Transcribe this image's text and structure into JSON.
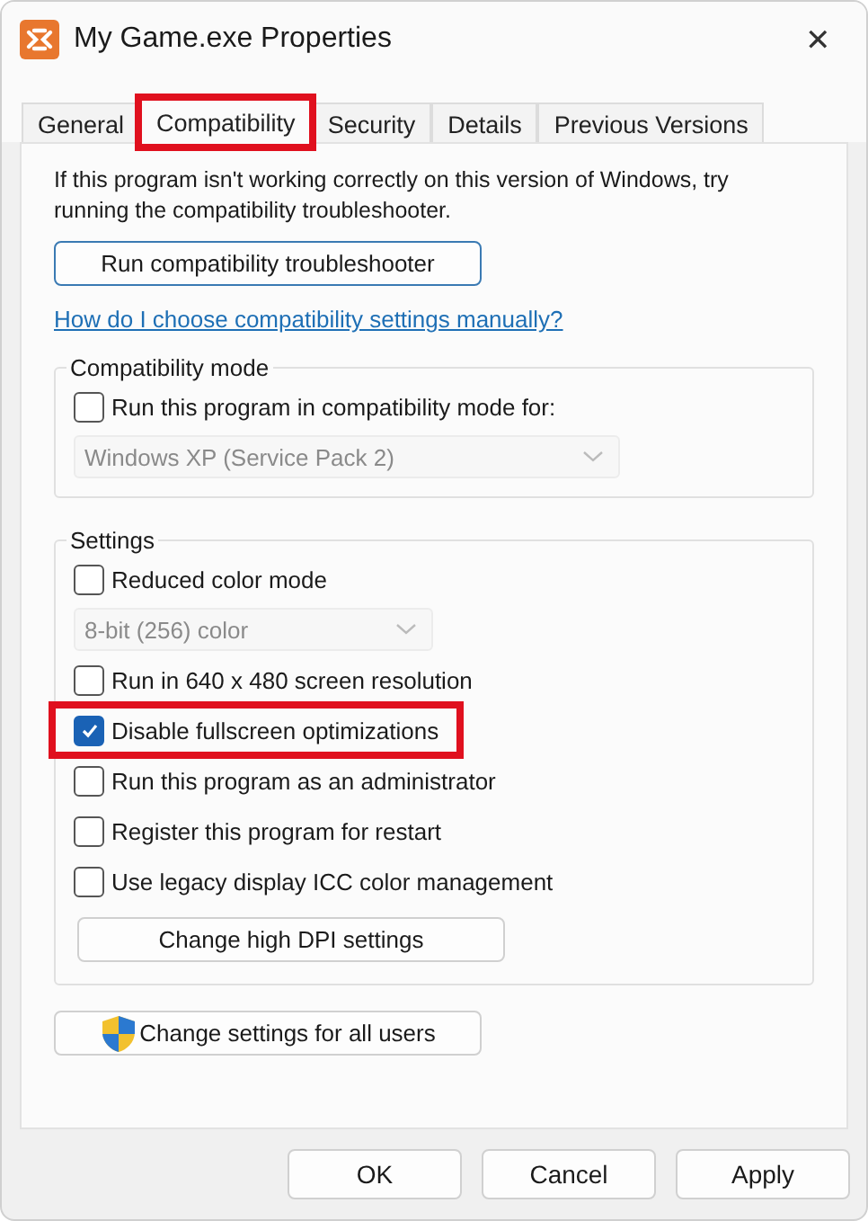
{
  "window": {
    "title": "My Game.exe Properties",
    "close": "✕"
  },
  "tabs": [
    {
      "label": "General",
      "selected": false,
      "highlighted": false
    },
    {
      "label": "Compatibility",
      "selected": true,
      "highlighted": true
    },
    {
      "label": "Security",
      "selected": false,
      "highlighted": false
    },
    {
      "label": "Details",
      "selected": false,
      "highlighted": false
    },
    {
      "label": "Previous Versions",
      "selected": false,
      "highlighted": false
    }
  ],
  "intro": "If this program isn't working correctly on this version of Windows, try running the compatibility troubleshooter.",
  "troubleshooter_button": "Run compatibility troubleshooter",
  "help_link": "How do I choose compatibility settings manually?",
  "groups": [
    {
      "title": "Compatibility mode",
      "items": [
        {
          "kind": "checkbox",
          "label": "Run this program in compatibility mode for:",
          "checked": false,
          "highlighted": false
        },
        {
          "kind": "select",
          "value": "Windows XP (Service Pack 2)",
          "disabled": true
        }
      ]
    },
    {
      "title": "Settings",
      "items": [
        {
          "kind": "checkbox",
          "label": "Reduced color mode",
          "checked": false,
          "highlighted": false
        },
        {
          "kind": "select",
          "value": "8-bit (256) color",
          "disabled": true
        },
        {
          "kind": "checkbox",
          "label": "Run in 640 x 480 screen resolution",
          "checked": false,
          "highlighted": false
        },
        {
          "kind": "checkbox",
          "label": "Disable fullscreen optimizations",
          "checked": true,
          "highlighted": true
        },
        {
          "kind": "checkbox",
          "label": "Run this program as an administrator",
          "checked": false,
          "highlighted": false
        },
        {
          "kind": "checkbox",
          "label": "Register this program for restart",
          "checked": false,
          "highlighted": false
        },
        {
          "kind": "checkbox",
          "label": "Use legacy display ICC color management",
          "checked": false,
          "highlighted": false
        },
        {
          "kind": "button",
          "label": "Change high DPI settings"
        }
      ]
    }
  ],
  "all_users_button": "Change settings for all users",
  "buttons": [
    "OK",
    "Cancel",
    "Apply"
  ]
}
